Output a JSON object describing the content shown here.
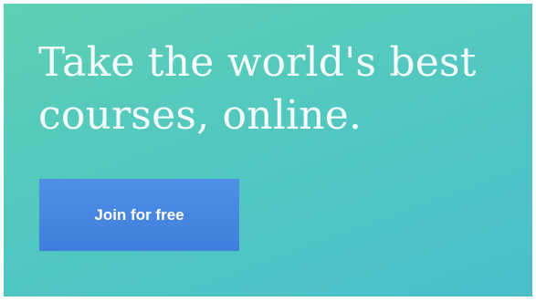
{
  "hero": {
    "headline_line1": "Take the world's best",
    "headline_line2": "courses, online.",
    "cta_label": "Join for free"
  },
  "colors": {
    "background_start": "#5ed0b3",
    "background_end": "#4bbfcb",
    "headline_text": "#f4fbfa",
    "button": "#4585e0",
    "button_text": "#ffffff"
  }
}
